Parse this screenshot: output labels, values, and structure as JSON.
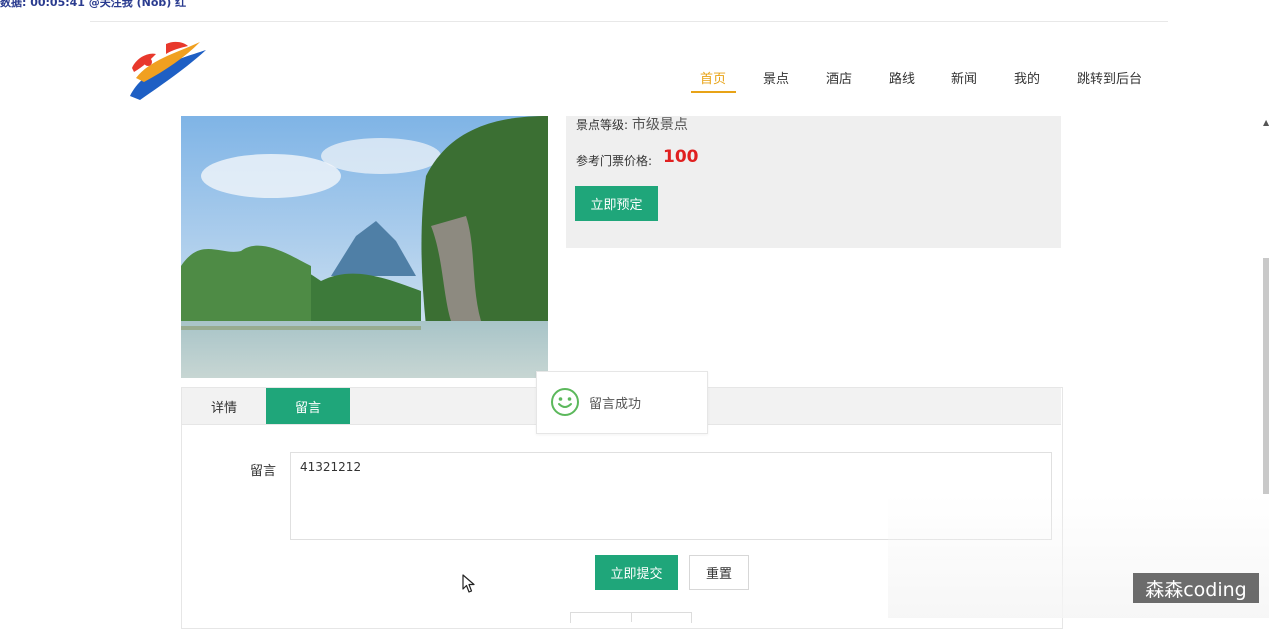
{
  "overlay": {
    "top_text": "数据: 00:05:41 @关注我 (Nob) 红"
  },
  "nav": {
    "items": [
      "首页",
      "景点",
      "酒店",
      "路线",
      "新闻",
      "我的",
      "跳转到后台"
    ],
    "active": "首页"
  },
  "spot": {
    "level_label": "景点等级:",
    "level_value": "市级景点",
    "price_label": "参考门票价格:",
    "price_value": "100",
    "book_button": "立即预定"
  },
  "tabs": {
    "detail": "详情",
    "comment": "留言"
  },
  "toast": {
    "message": "留言成功"
  },
  "form": {
    "comment_label": "留言",
    "comment_value": "41321212",
    "submit_button": "立即提交",
    "reset_button": "重置"
  },
  "watermark": "森森coding",
  "colors": {
    "accent": "#e8a317",
    "primary_green": "#1fa67a",
    "price_red": "#e02020"
  }
}
